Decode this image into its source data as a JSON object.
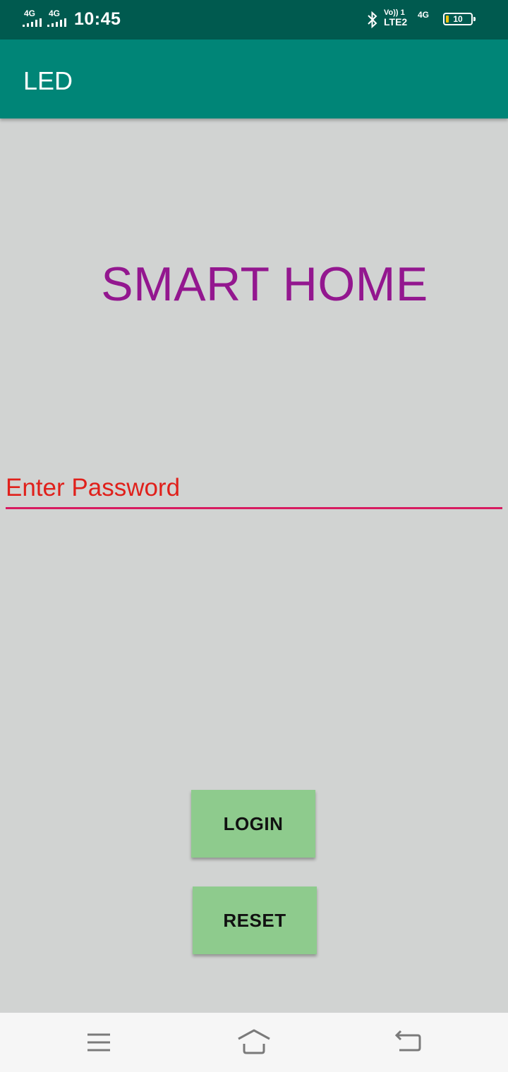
{
  "status_bar": {
    "sim1_network": "4G",
    "sim2_network": "4G",
    "time": "10:45",
    "volte_top": "Vo)) 1",
    "volte_bottom": "LTE2",
    "network_right": "4G",
    "battery_level": "10",
    "icons": [
      "signal-icon",
      "signal-icon",
      "bluetooth-icon",
      "battery-icon"
    ]
  },
  "app_bar": {
    "title": "LED",
    "color": "#008577"
  },
  "main": {
    "headline": "SMART HOME",
    "headline_color": "#93178f",
    "password_placeholder": "Enter Password",
    "password_value": "",
    "login_label": "LOGIN",
    "reset_label": "RESET",
    "button_color": "#8ecb8d"
  },
  "nav_bar": {
    "icons": [
      "menu-icon",
      "home-icon",
      "back-icon"
    ]
  }
}
